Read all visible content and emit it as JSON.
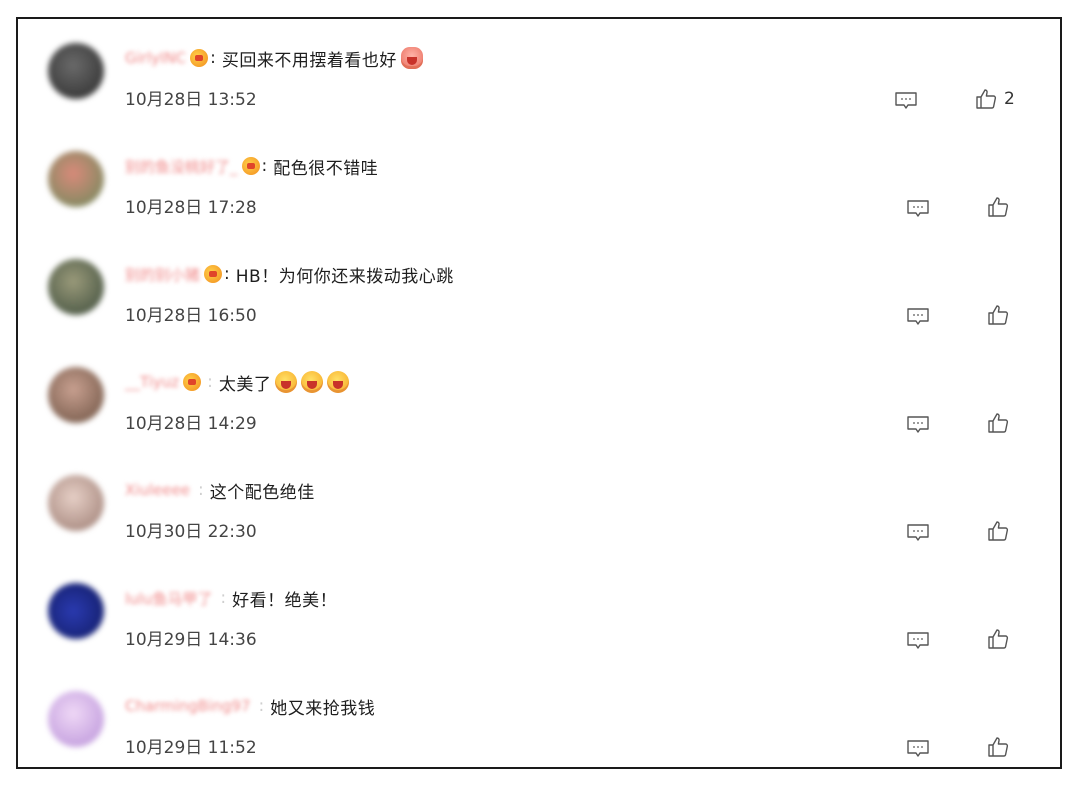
{
  "comments": [
    {
      "username": "GirlyINC",
      "text": "买回来不用摆着看也好",
      "emoji_after": "pig-emoji",
      "time": "10月28日 13:52",
      "likes": "2",
      "avatar_color": "#3b3b3b"
    },
    {
      "username": "别的鱼没桃好了_",
      "text": "配色很不错哇",
      "time": "10月28日 17:28",
      "likes": "",
      "avatar_color": "#b35a4a"
    },
    {
      "username": "别的别小猪",
      "text": "HB！为何你还来拨动我心跳",
      "time": "10月28日 16:50",
      "likes": "",
      "avatar_color": "#5e6a4a"
    },
    {
      "username": "__Tiyuz",
      "text": "太美了",
      "emoji_after": "crying-emoji",
      "time": "10月28日 14:29",
      "likes": "",
      "avatar_color": "#8a6a5a"
    },
    {
      "username": "Xiuleeee",
      "text": "这个配色绝佳",
      "time": "10月30日 22:30",
      "likes": "",
      "avatar_color": "#c9a8a0"
    },
    {
      "username": "lulu鱼马甲了",
      "text": "好看！绝美！",
      "time": "10月29日 14:36",
      "likes": "",
      "avatar_color": "#1a2a8a"
    },
    {
      "username": "CharmingBing97",
      "text": "她又来抢我钱",
      "time": "10月29日 11:52",
      "likes": "",
      "avatar_color": "#d9b8ea"
    }
  ],
  "icons": {
    "reply": "comment-reply-icon",
    "like": "thumbs-up-icon"
  },
  "colors": {
    "username": "#f08a8a",
    "text": "#1e1e1e",
    "timestamp": "#444444",
    "icon": "#555555"
  }
}
